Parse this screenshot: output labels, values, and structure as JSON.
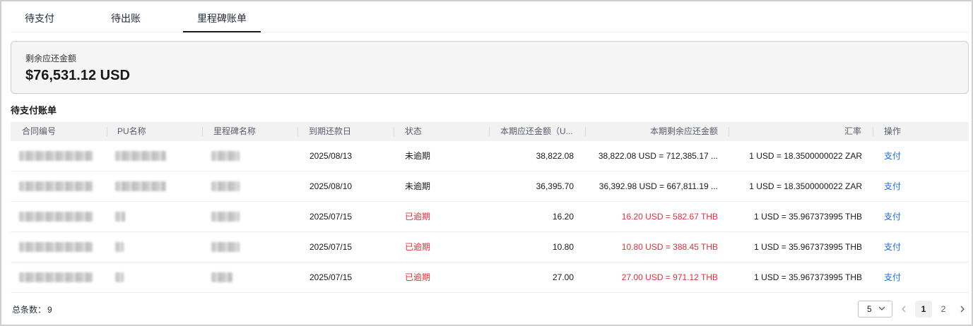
{
  "tabs": [
    "待支付",
    "待出账",
    "里程碑账单"
  ],
  "summary": {
    "label": "剩余应还金额",
    "amount": "$76,531.12 USD"
  },
  "section_title": "待支付账单",
  "table": {
    "headers": [
      "合同编号",
      "PU名称",
      "里程碑名称",
      "到期还款日",
      "状态",
      "本期应还金额（U...",
      "本期剩余应还金额",
      "汇率",
      "操作"
    ],
    "rows": [
      {
        "due": "2025/08/13",
        "status": "未逾期",
        "overdue": false,
        "amount": "38,822.08",
        "remaining": "38,822.08 USD = 712,385.17 ...",
        "rate": "1 USD = 18.3500000022 ZAR",
        "action": "支付"
      },
      {
        "due": "2025/08/10",
        "status": "未逾期",
        "overdue": false,
        "amount": "36,395.70",
        "remaining": "36,392.98 USD = 667,811.19 ...",
        "rate": "1 USD = 18.3500000022 ZAR",
        "action": "支付"
      },
      {
        "due": "2025/07/15",
        "status": "已逾期",
        "overdue": true,
        "amount": "16.20",
        "remaining": "16.20 USD = 582.67 THB",
        "rate": "1 USD = 35.967373995 THB",
        "action": "支付"
      },
      {
        "due": "2025/07/15",
        "status": "已逾期",
        "overdue": true,
        "amount": "10.80",
        "remaining": "10.80 USD = 388.45 THB",
        "rate": "1 USD = 35.967373995 THB",
        "action": "支付"
      },
      {
        "due": "2025/07/15",
        "status": "已逾期",
        "overdue": true,
        "amount": "27.00",
        "remaining": "27.00 USD = 971.12 THB",
        "rate": "1 USD = 35.967373995 THB",
        "action": "支付"
      }
    ]
  },
  "footer": {
    "total_label": "总条数：",
    "total": "9",
    "page_size": "5",
    "pages": [
      "1",
      "2"
    ],
    "current_page": "1"
  },
  "colors": {
    "overdue": "#e0303a",
    "link": "#1b6fd6",
    "active_tab": "#191919"
  },
  "icons": {
    "page_size": "chevron-down-icon",
    "prev": "chevron-left-icon",
    "next": "chevron-right-icon"
  }
}
